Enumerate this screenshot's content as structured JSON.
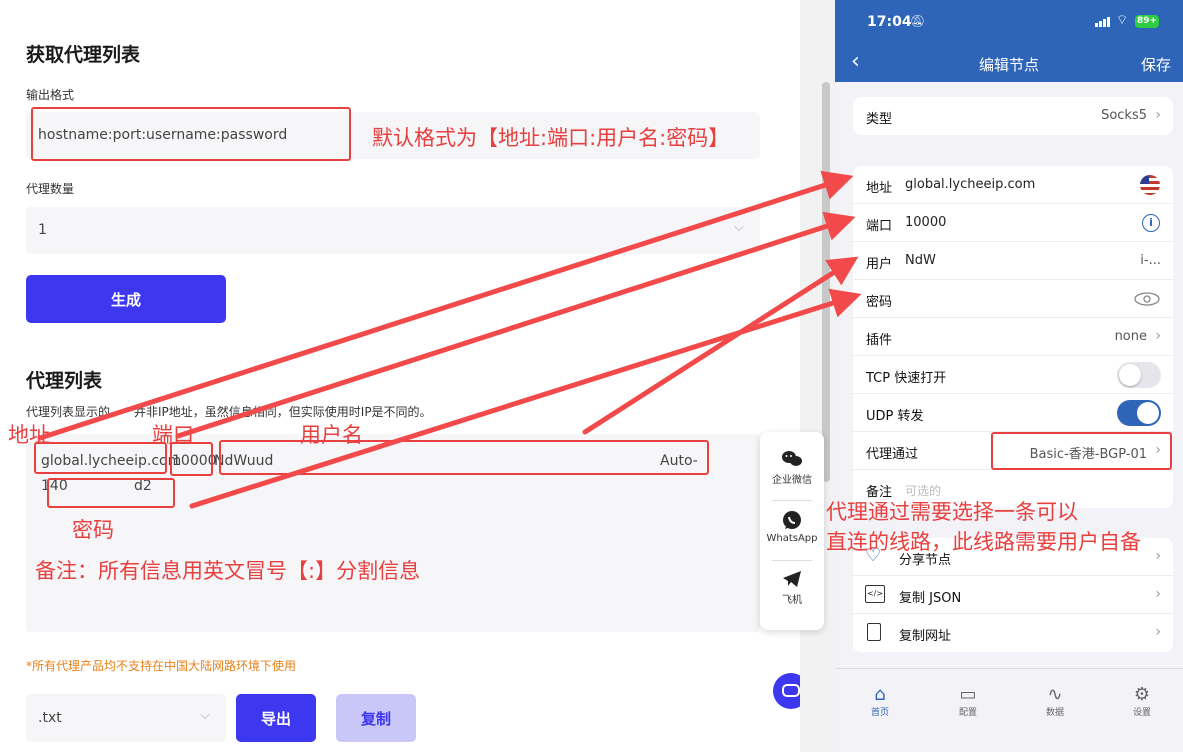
{
  "left": {
    "section1_title": "获取代理列表",
    "output_format_label": "输出格式",
    "output_format_value": "hostname:port:username:password",
    "proxy_count_label": "代理数量",
    "proxy_count_value": "1",
    "generate_button": "生成",
    "section2_title": "代理列表",
    "notice": "代理列表显示的",
    "notice_end": "并非IP地址，虽然信息相同，但实际使用时IP是不同的。",
    "result_host": "global.lycheeip.com",
    "result_port": "10000",
    "result_user": "NdWuud",
    "result_tail": "Auto-",
    "result_line2_a": "140",
    "result_line2_b": "d2",
    "warning": "*所有代理产品均不支持在中国大陆网路环境下使用",
    "export_format": ".txt",
    "export_button": "导出",
    "copy_button": "复制"
  },
  "side": {
    "wecom": "企业微信",
    "whatsapp": "WhatsApp",
    "telegram": "飞机"
  },
  "annotations": {
    "default_format": "默认格式为【地址:端口:用户名:密码】",
    "address": "地址",
    "port": "端口",
    "username": "用户名",
    "password": "密码",
    "note": "备注：所有信息用英文冒号【:】分割信息",
    "via_line1": "代理通过需要选择一条可以",
    "via_line2": "直连的线路，此线路需要用户自备"
  },
  "phone": {
    "time": "17:04",
    "battery": "89+",
    "nav_title": "编辑节点",
    "save": "保存",
    "type_label": "类型",
    "type_value": "Socks5",
    "address_label": "地址",
    "address_value": "global.lycheeip.com",
    "port_label": "端口",
    "port_value": "10000",
    "user_label": "用户",
    "user_value": "NdW",
    "user_tail": "i-...",
    "password_label": "密码",
    "plugin_label": "插件",
    "plugin_value": "none",
    "tcp_label": "TCP 快速打开",
    "udp_label": "UDP 转发",
    "via_label": "代理通过",
    "via_value": "Basic-香港-BGP-01",
    "remark_label": "备注",
    "remark_placeholder": "可选的",
    "share_node": "分享节点",
    "copy_json": "复制 JSON",
    "copy_url": "复制网址",
    "tabs": [
      "首页",
      "配置",
      "数据",
      "设置"
    ],
    "colors": {
      "nav": "#2f65b8",
      "toggle_on": "#2f65b8",
      "annotation": "#e8403f",
      "primary": "#3d37f0"
    }
  }
}
